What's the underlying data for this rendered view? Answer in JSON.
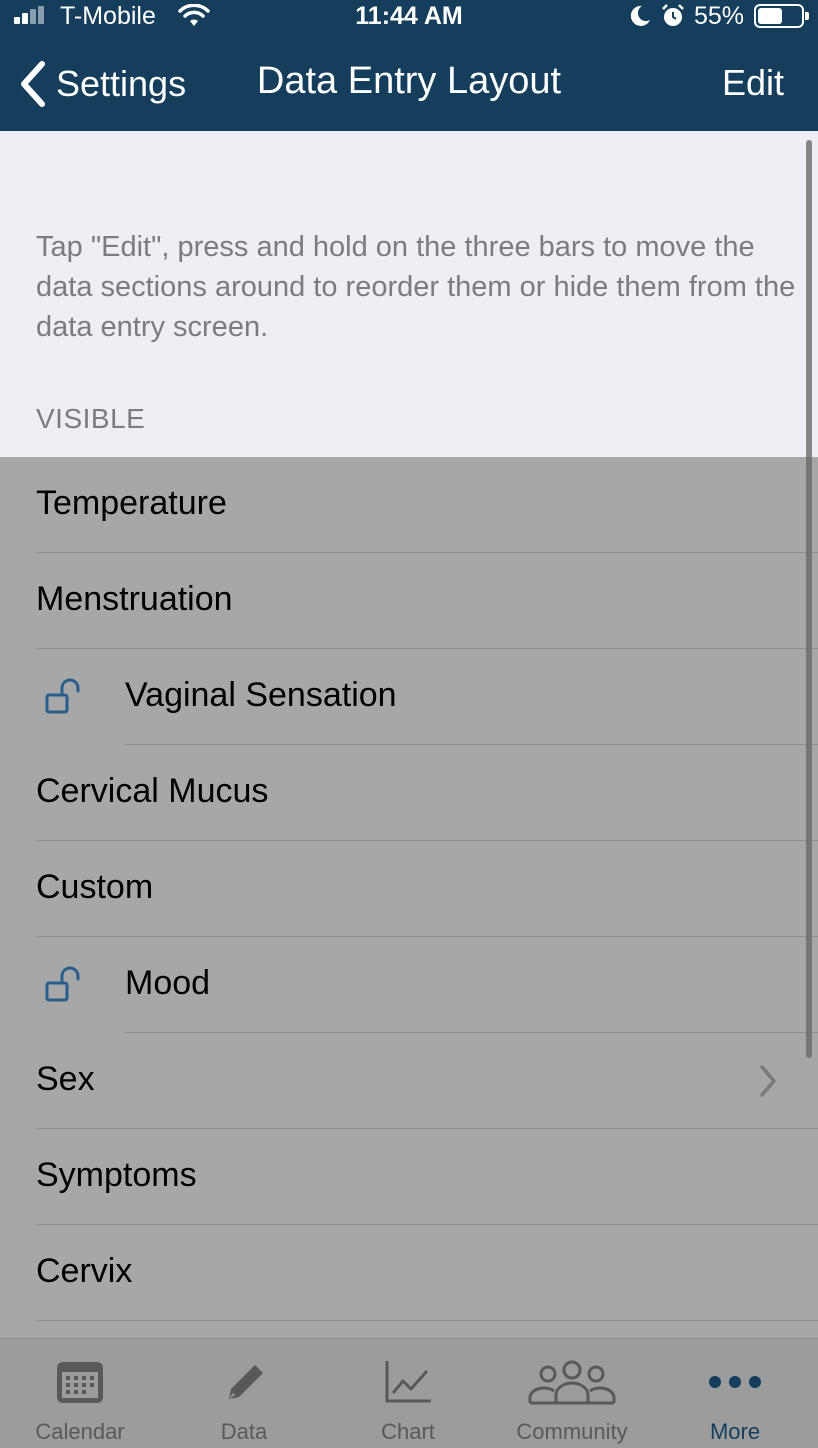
{
  "status_bar": {
    "carrier": "T-Mobile",
    "time": "11:44 AM",
    "battery": "55%"
  },
  "nav": {
    "back_label": "Settings",
    "title": "Data Entry Layout",
    "edit_label": "Edit"
  },
  "info": {
    "description": "Tap \"Edit\", press and hold on the three bars to move the data sections around to reorder them or hide them from the data entry screen.",
    "section_header": "VISIBLE"
  },
  "rows": [
    {
      "label": "Temperature",
      "locked": false,
      "disclosure": false
    },
    {
      "label": "Menstruation",
      "locked": false,
      "disclosure": false
    },
    {
      "label": "Vaginal Sensation",
      "locked": true,
      "disclosure": false
    },
    {
      "label": "Cervical Mucus",
      "locked": false,
      "disclosure": false
    },
    {
      "label": "Custom",
      "locked": false,
      "disclosure": false
    },
    {
      "label": "Mood",
      "locked": true,
      "disclosure": false
    },
    {
      "label": "Sex",
      "locked": false,
      "disclosure": true
    },
    {
      "label": "Symptoms",
      "locked": false,
      "disclosure": false
    },
    {
      "label": "Cervix",
      "locked": false,
      "disclosure": false
    }
  ],
  "tabs": [
    {
      "label": "Calendar",
      "icon": "calendar-icon",
      "active": false
    },
    {
      "label": "Data",
      "icon": "pencil-icon",
      "active": false
    },
    {
      "label": "Chart",
      "icon": "chart-icon",
      "active": false
    },
    {
      "label": "Community",
      "icon": "community-icon",
      "active": false
    },
    {
      "label": "More",
      "icon": "more-icon",
      "active": true
    }
  ],
  "colors": {
    "nav_bg": "#153d5c",
    "accent": "#153d5c",
    "lock_icon": "#2a5e8a"
  }
}
